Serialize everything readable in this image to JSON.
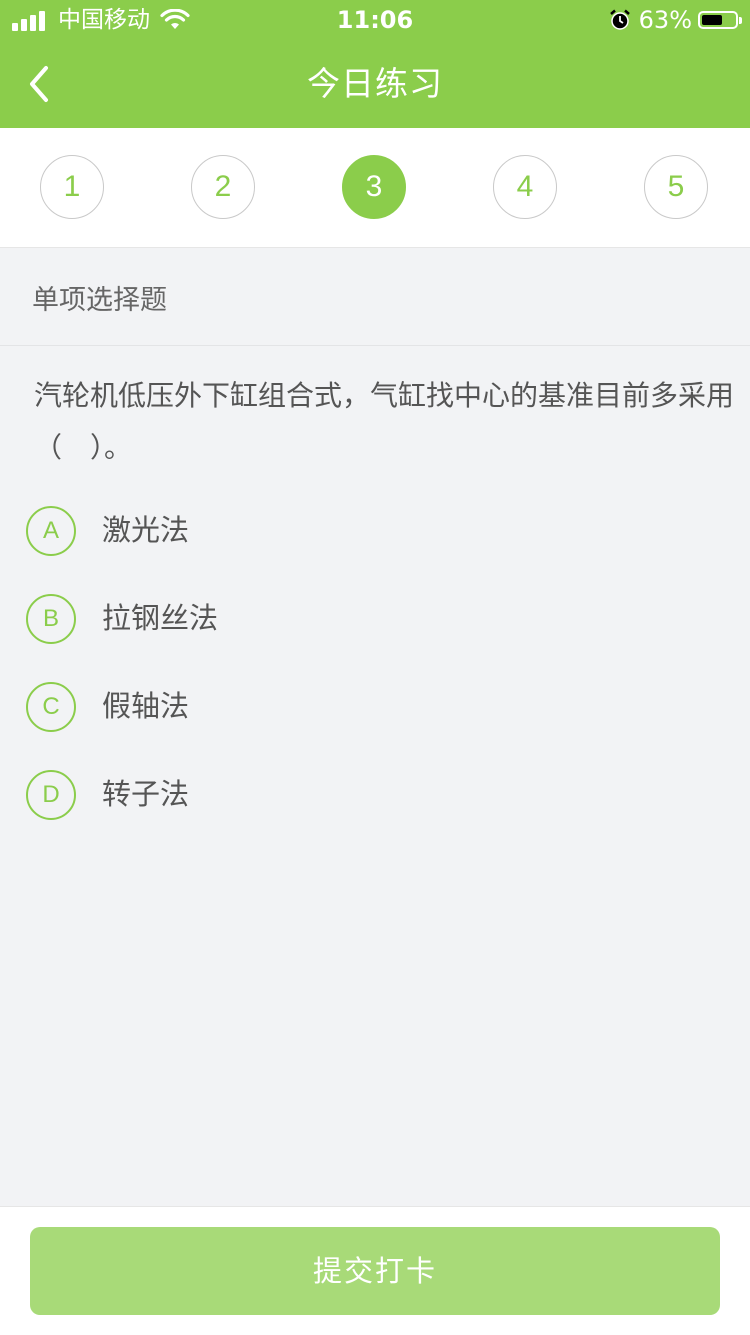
{
  "status_bar": {
    "carrier": "中国移动",
    "time": "11:06",
    "battery": "63%",
    "battery_level": 0.63
  },
  "header": {
    "title": "今日练习",
    "back_icon": "chevron-left-icon"
  },
  "question_nav": {
    "items": [
      {
        "label": "1",
        "active": false
      },
      {
        "label": "2",
        "active": false
      },
      {
        "label": "3",
        "active": true
      },
      {
        "label": "4",
        "active": false
      },
      {
        "label": "5",
        "active": false
      }
    ]
  },
  "question": {
    "type": "单项选择题",
    "text": "汽轮机低压外下缸组合式，气缸找中心的基准目前多采用（　）。",
    "options": [
      {
        "key": "A",
        "text": "激光法"
      },
      {
        "key": "B",
        "text": "拉钢丝法"
      },
      {
        "key": "C",
        "text": "假轴法"
      },
      {
        "key": "D",
        "text": "转子法"
      }
    ]
  },
  "footer": {
    "submit_label": "提交打卡"
  },
  "colors": {
    "primary": "#8bcd4b",
    "primary_light": "#a8da78",
    "background": "#f2f3f5"
  }
}
